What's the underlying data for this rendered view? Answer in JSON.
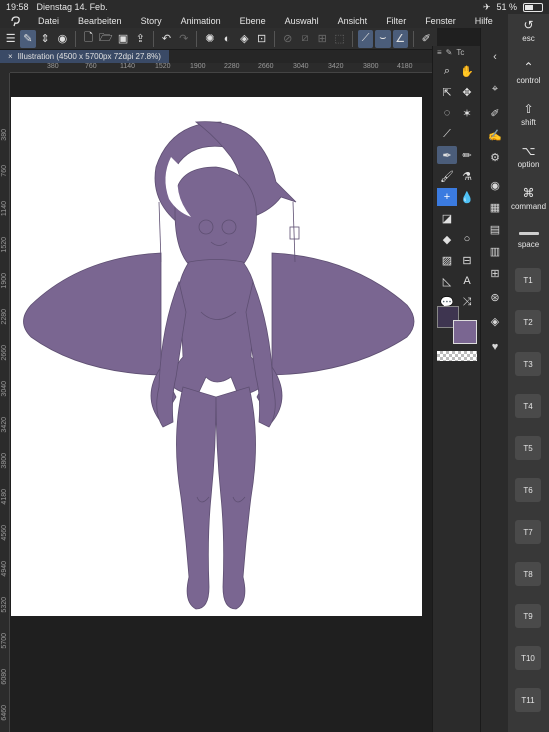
{
  "status": {
    "time": "19:58",
    "date": "Dienstag 14. Feb.",
    "battery": "51 %",
    "battery_level": 0.51
  },
  "menu": {
    "items": [
      "Datei",
      "Bearbeiten",
      "Story",
      "Animation",
      "Ebene",
      "Auswahl",
      "Ansicht",
      "Filter",
      "Fenster",
      "Hilfe"
    ]
  },
  "document": {
    "tab_label": "Illustration (4500 x 5700px 72dpi 27.8%)",
    "close_glyph": "×"
  },
  "rulers": {
    "horizontal": [
      "380",
      "760",
      "1140",
      "1520",
      "1900",
      "2280",
      "2660",
      "3040",
      "3420",
      "3800",
      "4180"
    ],
    "vertical": [
      "380",
      "760",
      "1140",
      "1520",
      "1900",
      "2280",
      "2660",
      "3040",
      "3420",
      "3800",
      "4180",
      "4560",
      "4940",
      "5320",
      "5700",
      "6080",
      "6460"
    ]
  },
  "palette": {
    "header_label": "Tc",
    "main_color": "#3e3550",
    "sub_color": "#7a6691"
  },
  "edge_keys": {
    "esc": "esc",
    "control": "control",
    "shift": "shift",
    "option": "option",
    "command": "command",
    "space": "space",
    "tkeys": [
      "T1",
      "T2",
      "T3",
      "T4",
      "T5",
      "T6",
      "T7",
      "T8",
      "T9",
      "T10",
      "T11"
    ]
  },
  "artwork": {
    "fill_color": "#7a6691",
    "line_color": "#5e4f72"
  }
}
